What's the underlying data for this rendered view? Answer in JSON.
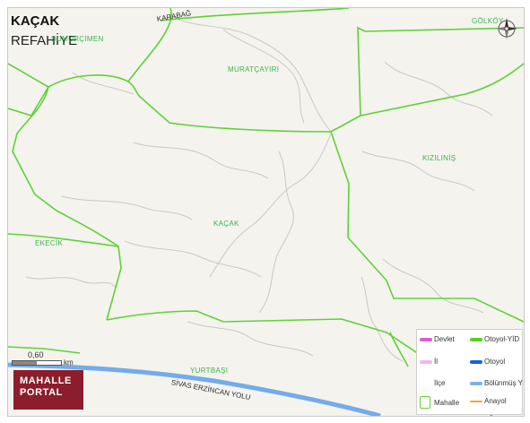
{
  "map": {
    "title": "KAÇAK",
    "subtitle": "REFAHİYE",
    "places": [
      {
        "key": "kacak",
        "label": "KAÇAK"
      },
      {
        "key": "muratcayiri",
        "label": "MURATÇAYIRI"
      },
      {
        "key": "kizilinis",
        "label": "KIZILINİŞ"
      },
      {
        "key": "ekecik",
        "label": "EKECİK"
      },
      {
        "key": "yurtbasi",
        "label": "YURTBAŞI"
      },
      {
        "key": "dumurcimen",
        "label": "DUMURÇİMEN"
      },
      {
        "key": "golkoy",
        "label": "GÖLKÖY"
      }
    ],
    "roads": {
      "sivas_erzincan": "SİVAS ERZİNCAN YOLU",
      "karabag": "KARABAĞ"
    },
    "compass_icon": "compass-rose-icon"
  },
  "scale": {
    "value": "0,60",
    "unit": "km"
  },
  "logo": {
    "line1": "MAHALLE",
    "line2": "PORTAL",
    "color": "#8c1d2c"
  },
  "legend": {
    "items": [
      {
        "label": "Devlet",
        "color": "#e05ad7"
      },
      {
        "label": "Otoyol-YİD",
        "color": "#4dd61f"
      },
      {
        "label": "İl",
        "color": "#f2b7ea"
      },
      {
        "label": "Otoyol",
        "color": "#1765d8"
      },
      {
        "label": "İlçe",
        "color": ""
      },
      {
        "label": "Bölünmüş Y",
        "color": "#7bb1ea"
      },
      {
        "label": "Mahalle",
        "color": "#5fd136"
      },
      {
        "label": "Anayol",
        "color": "#f3a43d"
      }
    ]
  },
  "colors": {
    "boundary": "#5fd136",
    "highway": "#74abea",
    "background": "#f4f3ee"
  }
}
